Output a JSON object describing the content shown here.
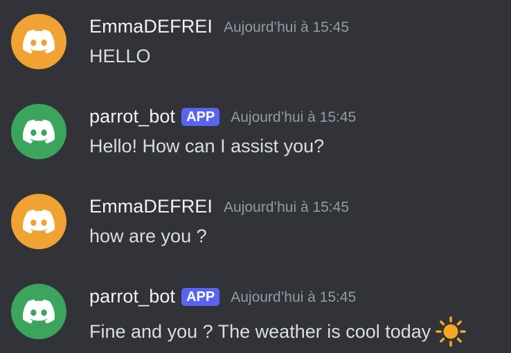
{
  "messages": [
    {
      "username": "EmmaDEFREI",
      "timestamp": "Aujourd’hui à 15:45",
      "text": "HELLO",
      "avatar_color": "#f0a232",
      "avatar_icon": "discord-logo-icon"
    },
    {
      "username": "parrot_bot",
      "badge": "APP",
      "timestamp": "Aujourd’hui à 15:45",
      "text": "Hello! How can I assist you?",
      "avatar_color": "#3ba55d",
      "avatar_icon": "discord-logo-icon"
    },
    {
      "username": "EmmaDEFREI",
      "timestamp": "Aujourd’hui à 15:45",
      "text": "how are you ?",
      "avatar_color": "#f0a232",
      "avatar_icon": "discord-logo-icon"
    },
    {
      "username": "parrot_bot",
      "badge": "APP",
      "timestamp": "Aujourd’hui à 15:45",
      "text": "Fine and you ? The weather is cool today",
      "emoji": "sun-emoji-icon",
      "avatar_color": "#3ba55d",
      "avatar_icon": "discord-logo-icon"
    }
  ],
  "colors": {
    "background": "#313338",
    "username": "#f2f3f5",
    "timestamp": "#949ba4",
    "message_text": "#dbdee1",
    "app_badge": "#5865f2",
    "sun": "#f5a623"
  }
}
